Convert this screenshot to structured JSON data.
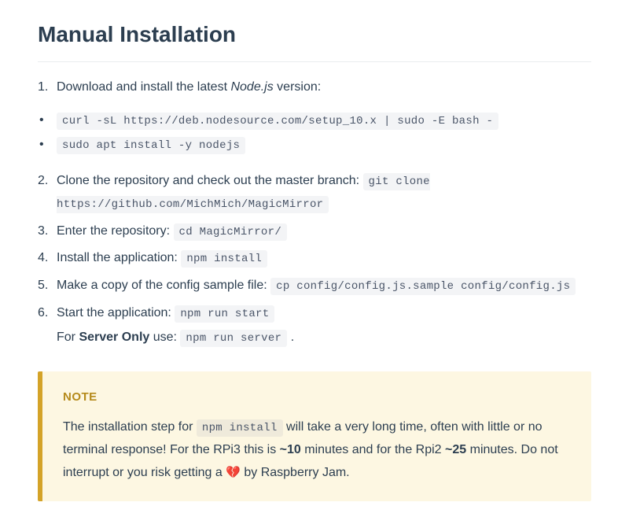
{
  "heading": "Manual Installation",
  "steps": {
    "s1": {
      "pre": "Download and install the latest ",
      "em": "Node.js",
      "post": " version:"
    },
    "bullets": {
      "b1": "curl -sL https://deb.nodesource.com/setup_10.x | sudo -E bash -",
      "b2": "sudo apt install -y nodejs"
    },
    "s2": {
      "text": "Clone the repository and check out the master branch: ",
      "code": "git clone https://github.com/MichMich/MagicMirror"
    },
    "s3": {
      "text": "Enter the repository: ",
      "code": "cd MagicMirror/"
    },
    "s4": {
      "text": "Install the application: ",
      "code": "npm install"
    },
    "s5": {
      "text": "Make a copy of the config sample file: ",
      "code": "cp config/config.js.sample config/config.js"
    },
    "s6": {
      "text": "Start the application: ",
      "code": "npm run start",
      "sub_pre": "For ",
      "sub_strong": "Server Only",
      "sub_mid": " use: ",
      "sub_code": "npm run server",
      "sub_post": " ."
    }
  },
  "note": {
    "label": "NOTE",
    "p1": "The installation step for ",
    "code1": "npm install",
    "p2": " will take a very long time, often with little or no terminal response! For the RPi3 this is ",
    "b1": "~10",
    "p3": " minutes and for the Rpi2 ",
    "b2": "~25",
    "p4": " minutes. Do not interrupt or you risk getting a ",
    "heart": "💔",
    "p5": " by Raspberry Jam."
  }
}
